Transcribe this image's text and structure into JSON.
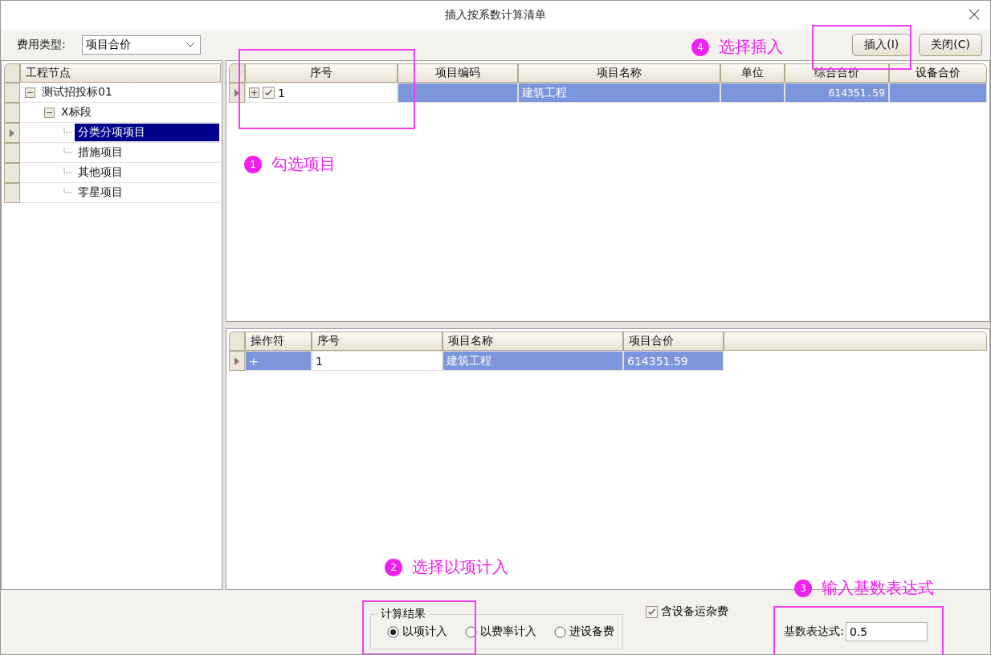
{
  "window": {
    "title": "插入按系数计算清单"
  },
  "toolbar": {
    "fee_type_label": "费用类型:",
    "fee_type_value": "项目合价",
    "buttons": [
      {
        "label": "插入(I)"
      },
      {
        "label": "关闭(C)"
      }
    ]
  },
  "tree": {
    "header": "工程节点",
    "nodes": [
      {
        "label": "测试招投标01",
        "expanded": true,
        "selected": false,
        "children": [
          {
            "label": "X标段",
            "expanded": true,
            "selected": false,
            "children": [
              {
                "label": "分类分项项目",
                "selected": true
              },
              {
                "label": "措施项目",
                "selected": false
              },
              {
                "label": "其他项目",
                "selected": false
              },
              {
                "label": "零星项目",
                "selected": false
              }
            ]
          }
        ]
      }
    ]
  },
  "top_table": {
    "columns": [
      "序号",
      "项目编码",
      "项目名称",
      "单位",
      "综合合价",
      "设备合价"
    ],
    "rows": [
      {
        "checked": true,
        "selected": true,
        "cells": [
          "1",
          "",
          "建筑工程",
          "",
          "614351.59",
          ""
        ]
      }
    ]
  },
  "bottom_table": {
    "columns": [
      "操作符",
      "序号",
      "项目名称",
      "项目合价"
    ],
    "rows": [
      {
        "selected": true,
        "cells": [
          "+",
          "1",
          "建筑工程",
          "614351.59"
        ]
      }
    ]
  },
  "calc_result": {
    "title": "计算结果",
    "options": [
      {
        "label": "以项计入",
        "selected": true
      },
      {
        "label": "以费率计入",
        "selected": false
      },
      {
        "label": "进设备费",
        "selected": false
      }
    ]
  },
  "include_transport": {
    "label": "含设备运杂费",
    "checked": true
  },
  "base_expression": {
    "label": "基数表达式:",
    "value": "0.5"
  },
  "annotations": [
    {
      "number": "1",
      "text": "勾选项目"
    },
    {
      "number": "2",
      "text": "选择以项计入"
    },
    {
      "number": "3",
      "text": "输入基数表达式"
    },
    {
      "number": "4",
      "text": "选择插入"
    }
  ]
}
